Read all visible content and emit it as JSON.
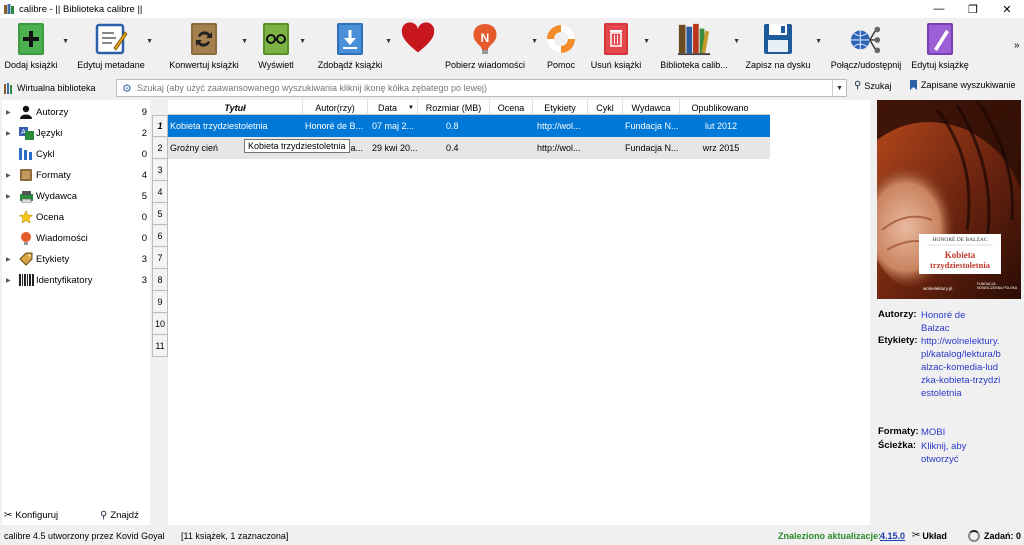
{
  "window": {
    "title": "calibre - || Biblioteka calibre ||",
    "minimize": "—",
    "maximize": "❐",
    "close": "✕"
  },
  "toolbar": {
    "items": [
      {
        "label": "Dodaj książki",
        "icon": "add-book-icon"
      },
      {
        "label": "Edytuj metadane",
        "icon": "edit-metadata-icon"
      },
      {
        "label": "Konwertuj książki",
        "icon": "convert-icon"
      },
      {
        "label": "Wyświetl",
        "icon": "view-icon"
      },
      {
        "label": "Zdobądź książki",
        "icon": "get-books-icon"
      },
      {
        "label": "",
        "icon": "heart-icon"
      },
      {
        "label": "Pobierz wiadomości",
        "icon": "news-icon"
      },
      {
        "label": "Pomoc",
        "icon": "help-lifebuoy-icon"
      },
      {
        "label": "Usuń książki",
        "icon": "trash-icon"
      },
      {
        "label": "Biblioteka calib...",
        "icon": "library-icon"
      },
      {
        "label": "Zapisz na dysku",
        "icon": "save-disk-icon"
      },
      {
        "label": "Połącz/udostępnij",
        "icon": "connect-share-icon"
      },
      {
        "label": "Edytuj książkę",
        "icon": "edit-book-icon"
      }
    ],
    "more": "»"
  },
  "search": {
    "virtual_library": "Wirtualna biblioteka",
    "placeholder": "Szukaj (aby użyć zaawansowanego wyszukiwania kliknij ikonę kółka zębatego po lewej)",
    "search_button": "Szukaj",
    "saved_searches": "Zapisane wyszukiwanie"
  },
  "tag_browser": {
    "items": [
      {
        "label": "Autorzy",
        "count": "9",
        "expandable": true,
        "icon": "person-icon"
      },
      {
        "label": "Języki",
        "count": "2",
        "expandable": true,
        "icon": "languages-icon"
      },
      {
        "label": "Cykl",
        "count": "0",
        "expandable": false,
        "icon": "series-icon"
      },
      {
        "label": "Formaty",
        "count": "4",
        "expandable": true,
        "icon": "formats-icon"
      },
      {
        "label": "Wydawca",
        "count": "5",
        "expandable": true,
        "icon": "publisher-icon"
      },
      {
        "label": "Ocena",
        "count": "0",
        "expandable": false,
        "icon": "star-icon"
      },
      {
        "label": "Wiadomości",
        "count": "0",
        "expandable": false,
        "icon": "news-small-icon"
      },
      {
        "label": "Etykiety",
        "count": "3",
        "expandable": true,
        "icon": "tags-icon"
      },
      {
        "label": "Identyfikatory",
        "count": "3",
        "expandable": true,
        "icon": "barcode-icon"
      }
    ],
    "configure": "Konfiguruj",
    "find": "Znajdź"
  },
  "book_list": {
    "columns": [
      "Tytuł",
      "Autor(rzy)",
      "Data",
      "Rozmiar (MB)",
      "Ocena",
      "Etykiety",
      "Cykl",
      "Wydawca",
      "Opublikowano"
    ],
    "row_numbers": [
      "1",
      "2",
      "3",
      "4",
      "5",
      "6",
      "7",
      "8",
      "9",
      "10",
      "11"
    ],
    "rows": [
      [
        "Kobieta trzydziestoletnia",
        "Honoré de B...",
        "07 maj 2...",
        "0.8",
        "",
        "http://wol...",
        "",
        "Fundacja N...",
        "lut 2012"
      ],
      [
        "Groźny cień",
        "...a...",
        "29 kwi 20...",
        "0.4",
        "",
        "http://wol...",
        "",
        "Fundacja N...",
        "wrz 2015"
      ]
    ],
    "tooltip": "Kobieta trzydziestoletnia"
  },
  "book_details": {
    "cover": {
      "author": "HONORÉ DE BALZAC",
      "title_line1": "Kobieta",
      "title_line2": "trzydziestoletnia",
      "publisher_logo": "wolnelektury.pl",
      "publisher2": "FUNDACJA NOWOCZESNA POLSKA"
    },
    "authors_label": "Autorzy:",
    "authors_value": "Honoré de Balzac",
    "tags_label": "Etykiety:",
    "tags_value": "http://wolnelektury.pl/katalog/lektura/balzac-komedia-ludzka-kobieta-trzydziestoletnia",
    "formats_label": "Formaty:",
    "formats_value": "MOBI",
    "path_label": "Ścieżka:",
    "path_value": "Kliknij, aby otworzyć"
  },
  "status": {
    "left": "calibre 4.5 utworzony przez Kovid Goyal",
    "count": "[11 książek, 1 zaznaczona]",
    "update_label": "Znaleziono aktualizacje:",
    "update_version": "4.15.0",
    "layout": "Układ",
    "jobs": "Zadań: 0"
  }
}
